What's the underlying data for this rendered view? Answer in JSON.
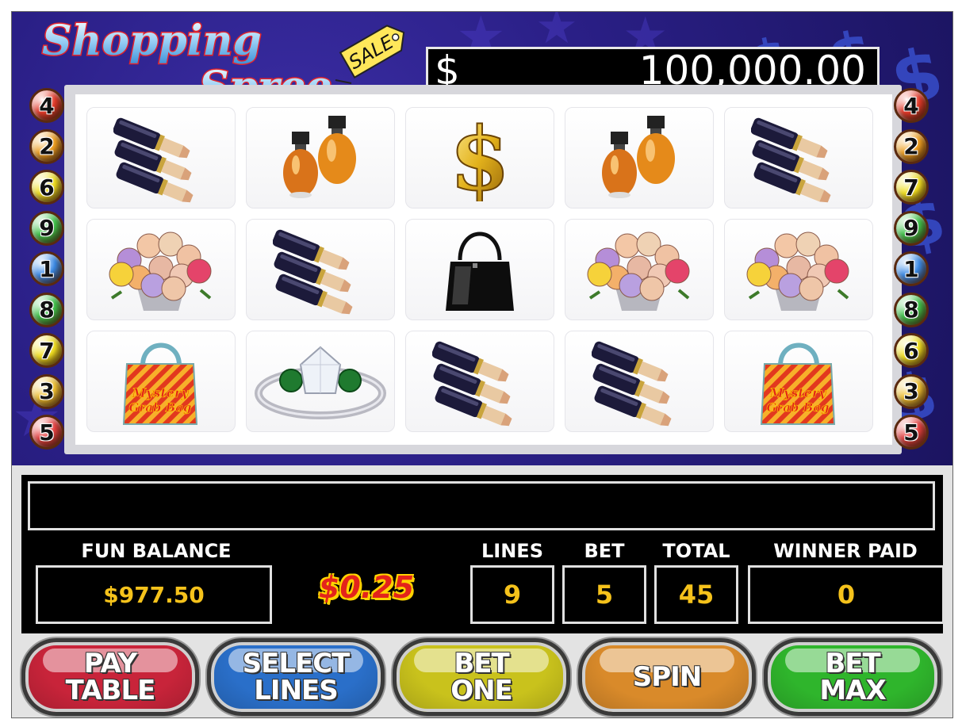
{
  "title": {
    "line1": "Shopping",
    "line2": "Spree",
    "tag": "SALE"
  },
  "jackpot": {
    "currency": "$",
    "amount": "100,000.00"
  },
  "paylines": {
    "left": [
      "4",
      "2",
      "6",
      "9",
      "1",
      "8",
      "7",
      "3",
      "5"
    ],
    "right": [
      "4",
      "2",
      "7",
      "9",
      "1",
      "8",
      "6",
      "3",
      "5"
    ]
  },
  "reels": [
    [
      "lipstick",
      "perfume",
      "dollar",
      "perfume",
      "lipstick"
    ],
    [
      "flowers",
      "lipstick",
      "handbag",
      "flowers",
      "flowers"
    ],
    [
      "mystery-bag",
      "ring",
      "lipstick",
      "lipstick",
      "mystery-bag"
    ]
  ],
  "mystery_bag_text": "Mystery Grab Bag",
  "message": "",
  "fun_balance": {
    "label": "FUN BALANCE",
    "value": "$977.50"
  },
  "coin_value": "$0.25",
  "lines": {
    "label": "LINES",
    "value": "9"
  },
  "bet": {
    "label": "BET",
    "value": "5"
  },
  "total": {
    "label": "TOTAL",
    "value": "45"
  },
  "winner_paid": {
    "label": "WINNER PAID",
    "value": "0"
  },
  "buttons": {
    "pay_table": "PAY\nTABLE",
    "select_lines": "SELECT\nLINES",
    "bet_one": "BET\nONE",
    "spin": "SPIN",
    "bet_max": "BET\nMAX"
  },
  "colors": {
    "pay_table": "#c8243a",
    "select_lines": "#2a6fc9",
    "bet_one": "#c9c21c",
    "spin": "#d98a2a",
    "bet_max": "#2fb52c",
    "value_text": "#f5c21b"
  }
}
